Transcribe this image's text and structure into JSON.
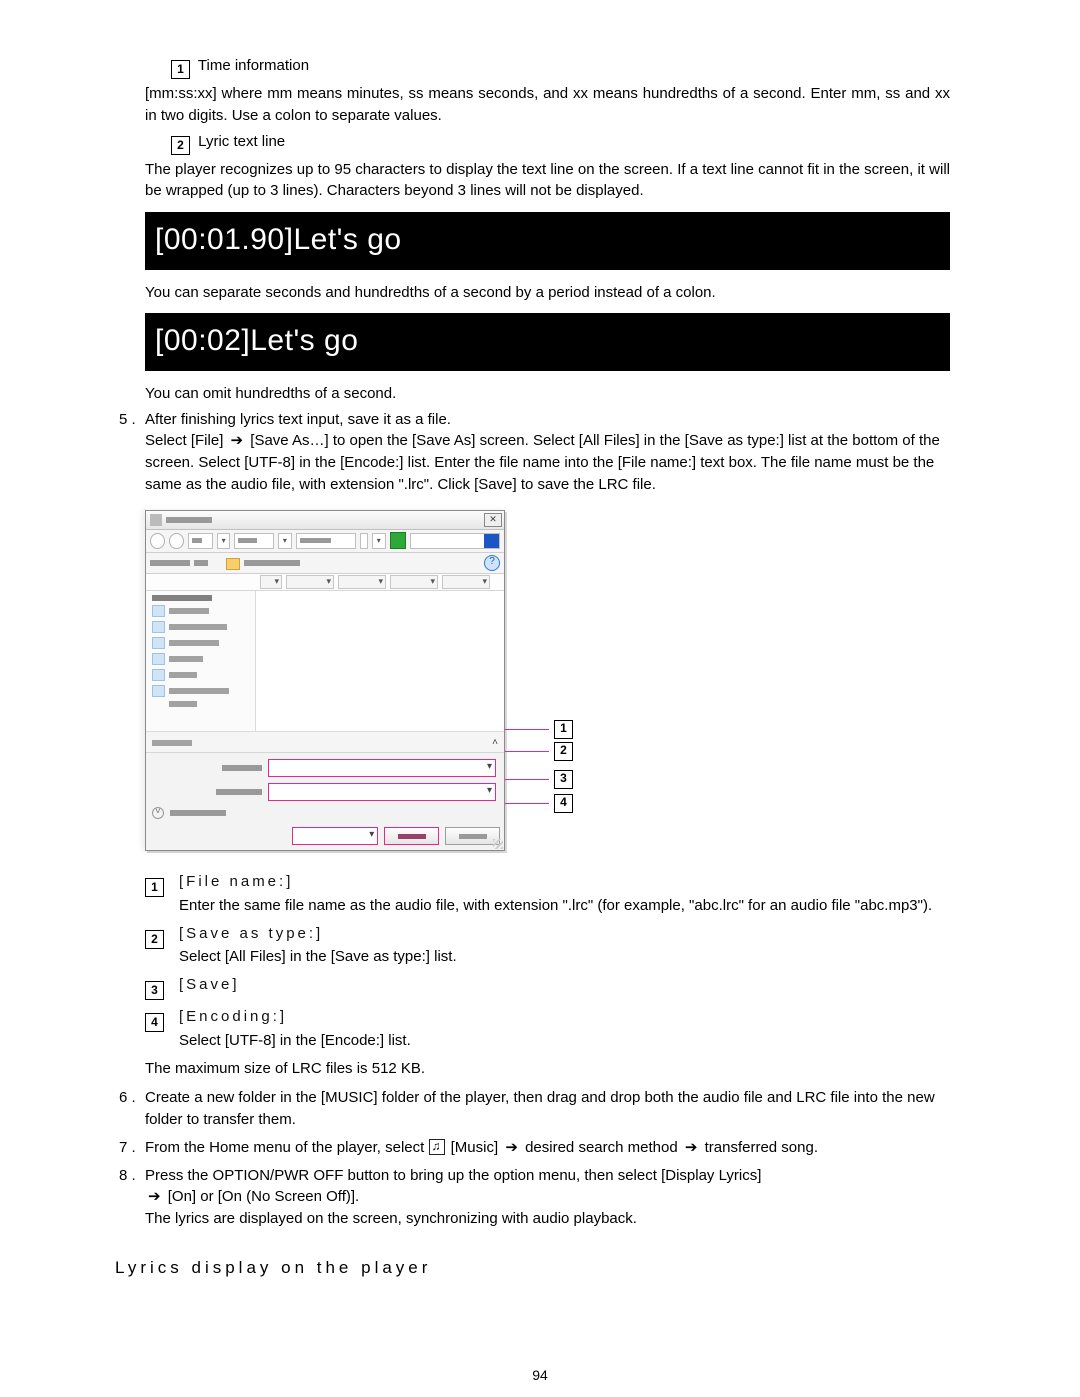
{
  "annotations": {
    "a1_title": "Time information",
    "a1_body": "[mm:ss:xx] where mm means minutes, ss means seconds, and xx means hundredths of a second. Enter mm, ss and xx in two digits. Use a colon to separate values.",
    "a2_title": "Lyric text line",
    "a2_body": "The player recognizes up to 95 characters to display the text line on the screen. If a text line cannot fit in the screen, it will be wrapped (up to 3 lines). Characters beyond 3 lines will not be displayed."
  },
  "example1": "[00:01.90]Let's go",
  "between_examples": "You can separate seconds and hundredths of a second by a period instead of a colon.",
  "example2": "[00:02]Let's go",
  "after_example2": "You can omit hundredths of a second.",
  "step5_num": "5 .",
  "step5_line1": "After finishing lyrics text input, save it as a file.",
  "step5_a": "Select [File]  ",
  "step5_b": "  [Save As…] to open the [Save As] screen. Select [All Files] in the [Save as type:] list at the bottom of the screen. Select [UTF-8] in the [Encode:] list. Enter the file name into the [File name:] text box. The file name must be the same as the audio file, with extension \".lrc\". Click [Save] to save the LRC file.",
  "defs": {
    "d1_term": "[File name:]",
    "d1_body": "Enter the same file name as the audio file, with extension \".lrc\" (for example, \"abc.lrc\" for an audio file \"abc.mp3\").",
    "d2_term": "[Save as type:]",
    "d2_body": "Select [All Files] in the [Save as type:] list.",
    "d3_term": "[Save]",
    "d4_term": "[Encoding:]",
    "d4_body": "Select [UTF-8] in the [Encode:] list."
  },
  "maxsize": "The maximum size of LRC files is 512 KB.",
  "step6_num": "6 .",
  "step6": "Create a new folder in the [MUSIC] folder of the player, then drag and drop both the audio file and LRC file into the new folder to transfer them.",
  "step7_num": "7 .",
  "step7_a": "From the Home menu of the player, select ",
  "step7_b": "[Music]  ",
  "step7_c": "  desired search method  ",
  "step7_d": "  transferred song.",
  "step8_num": "8 .",
  "step8_a": "Press the OPTION/PWR OFF button to bring up the option menu, then select [Display Lyrics] ",
  "step8_b": "  [On] or [On (No Screen Off)].",
  "step8_c": "The lyrics are displayed on the screen, synchronizing with audio playback.",
  "section_head": "Lyrics display on the player",
  "page_number": "94",
  "callout_numbers": {
    "n1": "1",
    "n2": "2",
    "n3": "3",
    "n4": "4"
  }
}
